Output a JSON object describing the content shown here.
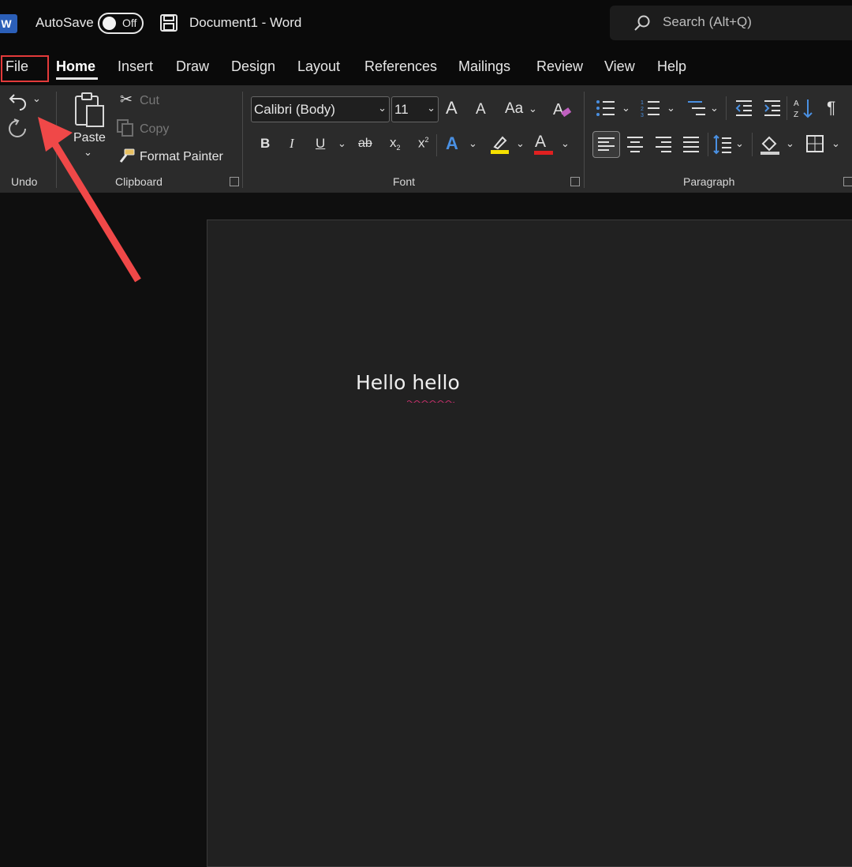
{
  "titlebar": {
    "app_icon": "word-logo",
    "app_icon_letter": "W",
    "autosave_label": "AutoSave",
    "autosave_state": "Off",
    "save_icon": "save-icon",
    "document_title": "Document1  -  Word",
    "search_placeholder": "Search (Alt+Q)"
  },
  "tabs": [
    {
      "label": "File"
    },
    {
      "label": "Home"
    },
    {
      "label": "Insert"
    },
    {
      "label": "Draw"
    },
    {
      "label": "Design"
    },
    {
      "label": "Layout"
    },
    {
      "label": "References"
    },
    {
      "label": "Mailings"
    },
    {
      "label": "Review"
    },
    {
      "label": "View"
    },
    {
      "label": "Help"
    }
  ],
  "active_tab": "Home",
  "ribbon": {
    "undo": {
      "group_label": "Undo"
    },
    "clipboard": {
      "group_label": "Clipboard",
      "paste_label": "Paste",
      "cut_label": "Cut",
      "copy_label": "Copy",
      "format_painter_label": "Format Painter"
    },
    "font": {
      "group_label": "Font",
      "font_name": "Calibri (Body)",
      "font_size": "11",
      "bold": "B",
      "italic": "I",
      "underline": "U",
      "strike": "ab",
      "subscript": "x",
      "subscript_mark": "2",
      "superscript": "x",
      "superscript_mark": "2",
      "change_case": "Aa",
      "grow": "A",
      "shrink": "A",
      "text_effects": "A",
      "font_color": "A"
    },
    "paragraph": {
      "group_label": "Paragraph",
      "show_marks": "¶"
    }
  },
  "document": {
    "body_text_1": "Hello ",
    "body_text_2": "hello"
  },
  "colors": {
    "highlight_yellow": "#f5e000",
    "font_color_red": "#e02020",
    "text_effects_blue": "#4a90e2",
    "annotation_red": "#e33a3a",
    "word_blue": "#2b5fb8"
  }
}
